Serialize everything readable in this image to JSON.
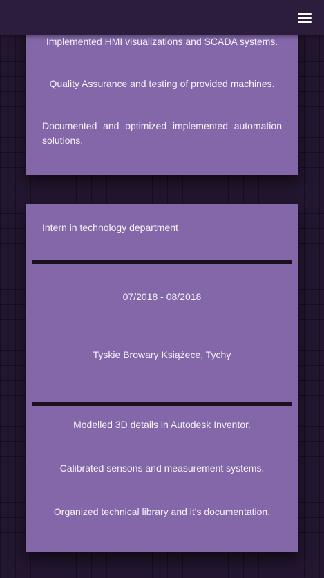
{
  "card1": {
    "items": [
      "Implemented HMI visualizations and SCADA systems.",
      "Quality Assurance and testing of provided machines.",
      "Documented and optimized implemented automation solutions."
    ]
  },
  "card2": {
    "position": "Intern in technology department",
    "dates": "07/2018 - 08/2018",
    "company": "Tyskie Browary Książece, Tychy",
    "items": [
      "Modelled 3D details in Autodesk Inventor.",
      "Calibrated sensons and measurement systems.",
      "Organized technical library and it's documentation."
    ]
  }
}
